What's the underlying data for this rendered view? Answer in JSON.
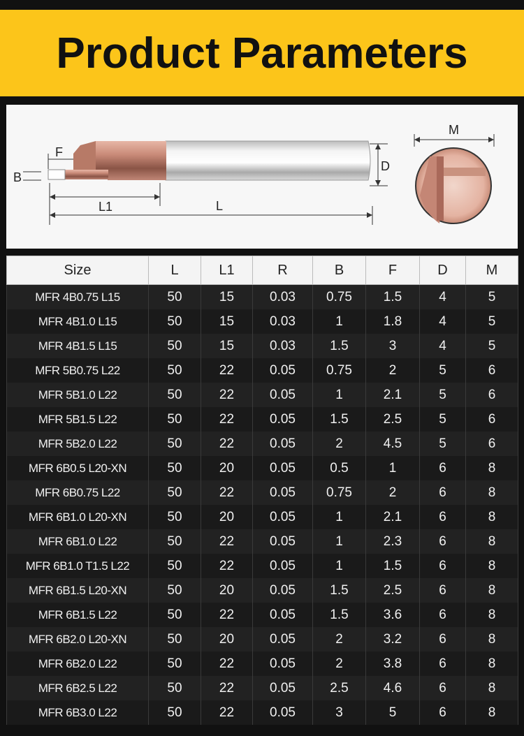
{
  "banner": {
    "title": "Product Parameters"
  },
  "diagram": {
    "labels": {
      "F": "F",
      "B": "B",
      "L1": "L1",
      "L": "L",
      "D": "D",
      "M": "M"
    }
  },
  "table": {
    "headers": [
      "Size",
      "L",
      "L1",
      "R",
      "B",
      "F",
      "D",
      "M"
    ],
    "rows": [
      [
        "MFR 4B0.75 L15",
        "50",
        "15",
        "0.03",
        "0.75",
        "1.5",
        "4",
        "5"
      ],
      [
        "MFR 4B1.0 L15",
        "50",
        "15",
        "0.03",
        "1",
        "1.8",
        "4",
        "5"
      ],
      [
        "MFR 4B1.5 L15",
        "50",
        "15",
        "0.03",
        "1.5",
        "3",
        "4",
        "5"
      ],
      [
        "MFR 5B0.75 L22",
        "50",
        "22",
        "0.05",
        "0.75",
        "2",
        "5",
        "6"
      ],
      [
        "MFR 5B1.0 L22",
        "50",
        "22",
        "0.05",
        "1",
        "2.1",
        "5",
        "6"
      ],
      [
        "MFR 5B1.5 L22",
        "50",
        "22",
        "0.05",
        "1.5",
        "2.5",
        "5",
        "6"
      ],
      [
        "MFR 5B2.0 L22",
        "50",
        "22",
        "0.05",
        "2",
        "4.5",
        "5",
        "6"
      ],
      [
        "MFR 6B0.5 L20-XN",
        "50",
        "20",
        "0.05",
        "0.5",
        "1",
        "6",
        "8"
      ],
      [
        "MFR 6B0.75 L22",
        "50",
        "22",
        "0.05",
        "0.75",
        "2",
        "6",
        "8"
      ],
      [
        "MFR 6B1.0 L20-XN",
        "50",
        "20",
        "0.05",
        "1",
        "2.1",
        "6",
        "8"
      ],
      [
        "MFR 6B1.0 L22",
        "50",
        "22",
        "0.05",
        "1",
        "2.3",
        "6",
        "8"
      ],
      [
        "MFR 6B1.0 T1.5 L22",
        "50",
        "22",
        "0.05",
        "1",
        "1.5",
        "6",
        "8"
      ],
      [
        "MFR 6B1.5 L20-XN",
        "50",
        "20",
        "0.05",
        "1.5",
        "2.5",
        "6",
        "8"
      ],
      [
        "MFR 6B1.5 L22",
        "50",
        "22",
        "0.05",
        "1.5",
        "3.6",
        "6",
        "8"
      ],
      [
        "MFR 6B2.0 L20-XN",
        "50",
        "20",
        "0.05",
        "2",
        "3.2",
        "6",
        "8"
      ],
      [
        "MFR 6B2.0 L22",
        "50",
        "22",
        "0.05",
        "2",
        "3.8",
        "6",
        "8"
      ],
      [
        "MFR 6B2.5 L22",
        "50",
        "22",
        "0.05",
        "2.5",
        "4.6",
        "6",
        "8"
      ],
      [
        "MFR 6B3.0 L22",
        "50",
        "22",
        "0.05",
        "3",
        "5",
        "6",
        "8"
      ]
    ]
  }
}
